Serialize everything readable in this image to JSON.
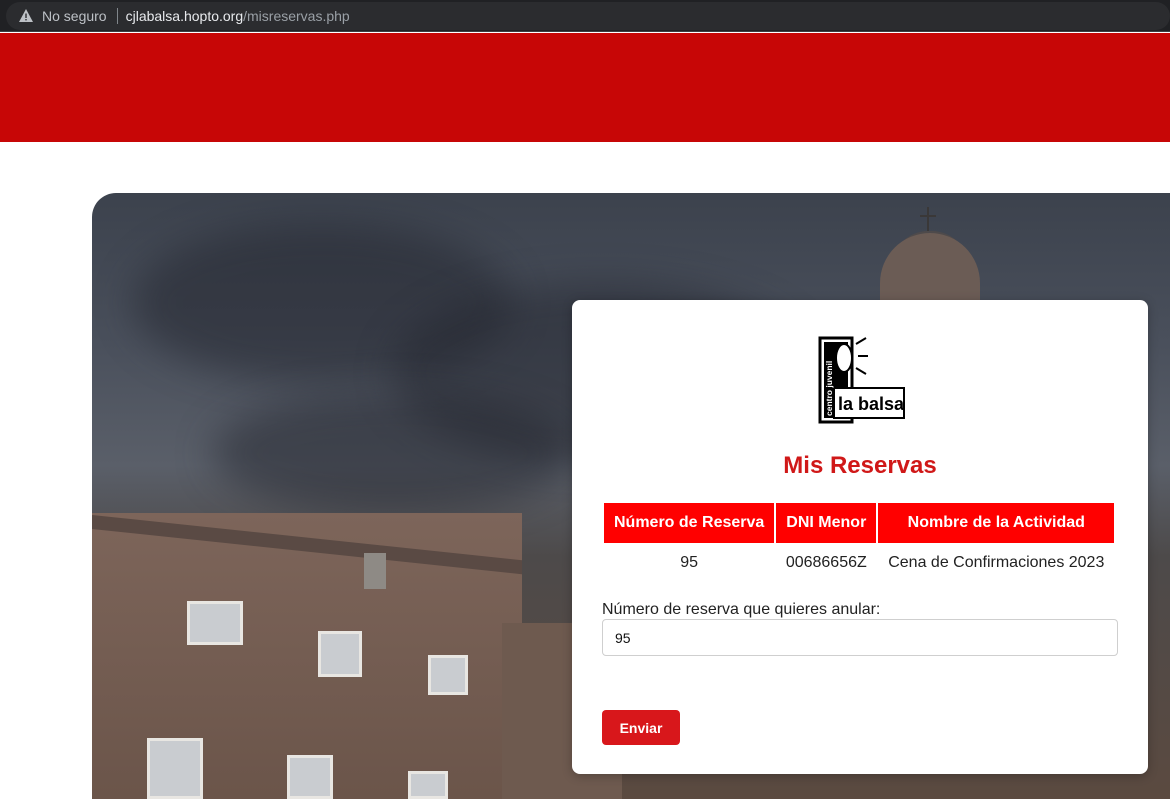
{
  "browser": {
    "security_label": "No seguro",
    "url_host": "cjlabalsa.hopto.org",
    "url_path": "/misreservas.php"
  },
  "logo": {
    "vertical_text": "centro juvenil",
    "main_text": "la balsa"
  },
  "page": {
    "title": "Mis Reservas",
    "accent_color": "#d01818",
    "header_color": "#c70606"
  },
  "table": {
    "headers": [
      "Número de Reserva",
      "DNI Menor",
      "Nombre de la Actividad"
    ],
    "rows": [
      [
        "95",
        "00686656Z",
        "Cena de Confirmaciones 2023"
      ]
    ]
  },
  "form": {
    "label": "Número de reserva que quieres anular:",
    "value": "95",
    "submit_label": "Enviar"
  }
}
